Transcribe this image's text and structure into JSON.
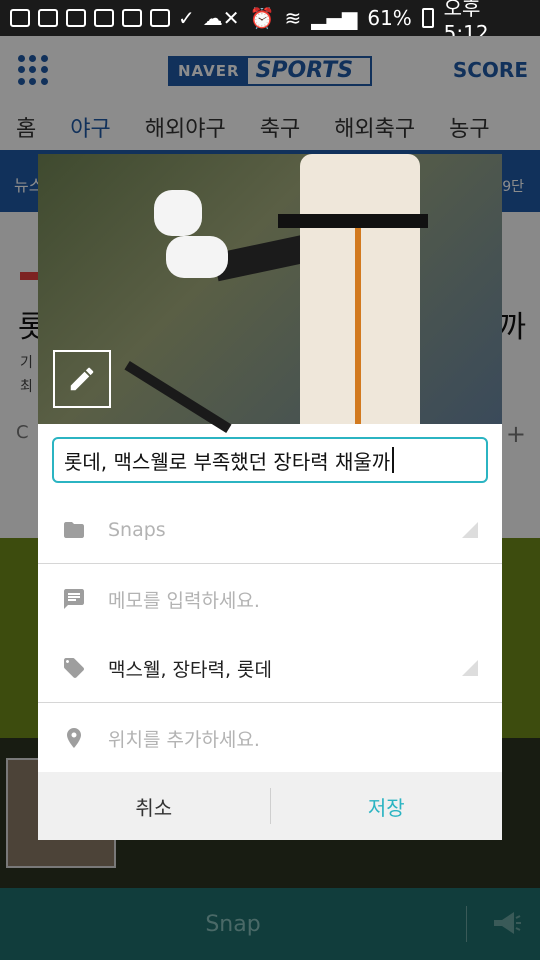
{
  "status_bar": {
    "battery": "61%",
    "time": "오후 5:12"
  },
  "app": {
    "brand_naver": "NAVER",
    "brand_sports": "SPORTS",
    "score_link": "SCORE",
    "tabs": [
      {
        "label": "홈"
      },
      {
        "label": "야구",
        "active": true
      },
      {
        "label": "해외야구"
      },
      {
        "label": "축구"
      },
      {
        "label": "해외축구"
      },
      {
        "label": "농구"
      }
    ],
    "subbar_left": "뉴스",
    "subbar_right": "9단"
  },
  "background_article": {
    "headline_left": "롯",
    "headline_right": "까",
    "line1": "기",
    "line2": "최",
    "plus_left": "C",
    "plus_right": "+"
  },
  "dialog": {
    "title_value": "롯데, 맥스웰로 부족했던 장타력 채울까",
    "folder": {
      "icon": "folder-icon",
      "label": "Snaps"
    },
    "memo": {
      "icon": "comment-icon",
      "placeholder": "메모를 입력하세요."
    },
    "tags": {
      "icon": "tag-icon",
      "value": "맥스웰, 장타력, 롯데"
    },
    "location": {
      "icon": "location-pin-icon",
      "placeholder": "위치를 추가하세요."
    },
    "cancel_label": "취소",
    "save_label": "저장"
  },
  "bottom_bar": {
    "snap_label": "Snap",
    "action_icon": "megaphone-icon"
  },
  "colors": {
    "brand_blue": "#1f5aa6",
    "accent_teal": "#2bb4c2",
    "bottom_bar": "#1f6f6d"
  }
}
